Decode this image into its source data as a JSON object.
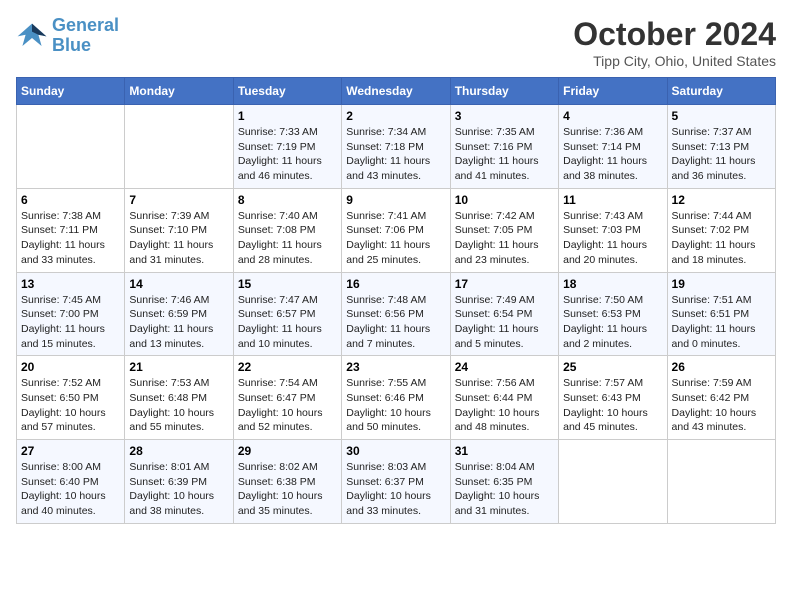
{
  "header": {
    "logo_line1": "General",
    "logo_line2": "Blue",
    "month": "October 2024",
    "location": "Tipp City, Ohio, United States"
  },
  "weekdays": [
    "Sunday",
    "Monday",
    "Tuesday",
    "Wednesday",
    "Thursday",
    "Friday",
    "Saturday"
  ],
  "weeks": [
    [
      {
        "day": "",
        "sunrise": "",
        "sunset": "",
        "daylight": ""
      },
      {
        "day": "",
        "sunrise": "",
        "sunset": "",
        "daylight": ""
      },
      {
        "day": "1",
        "sunrise": "Sunrise: 7:33 AM",
        "sunset": "Sunset: 7:19 PM",
        "daylight": "Daylight: 11 hours and 46 minutes."
      },
      {
        "day": "2",
        "sunrise": "Sunrise: 7:34 AM",
        "sunset": "Sunset: 7:18 PM",
        "daylight": "Daylight: 11 hours and 43 minutes."
      },
      {
        "day": "3",
        "sunrise": "Sunrise: 7:35 AM",
        "sunset": "Sunset: 7:16 PM",
        "daylight": "Daylight: 11 hours and 41 minutes."
      },
      {
        "day": "4",
        "sunrise": "Sunrise: 7:36 AM",
        "sunset": "Sunset: 7:14 PM",
        "daylight": "Daylight: 11 hours and 38 minutes."
      },
      {
        "day": "5",
        "sunrise": "Sunrise: 7:37 AM",
        "sunset": "Sunset: 7:13 PM",
        "daylight": "Daylight: 11 hours and 36 minutes."
      }
    ],
    [
      {
        "day": "6",
        "sunrise": "Sunrise: 7:38 AM",
        "sunset": "Sunset: 7:11 PM",
        "daylight": "Daylight: 11 hours and 33 minutes."
      },
      {
        "day": "7",
        "sunrise": "Sunrise: 7:39 AM",
        "sunset": "Sunset: 7:10 PM",
        "daylight": "Daylight: 11 hours and 31 minutes."
      },
      {
        "day": "8",
        "sunrise": "Sunrise: 7:40 AM",
        "sunset": "Sunset: 7:08 PM",
        "daylight": "Daylight: 11 hours and 28 minutes."
      },
      {
        "day": "9",
        "sunrise": "Sunrise: 7:41 AM",
        "sunset": "Sunset: 7:06 PM",
        "daylight": "Daylight: 11 hours and 25 minutes."
      },
      {
        "day": "10",
        "sunrise": "Sunrise: 7:42 AM",
        "sunset": "Sunset: 7:05 PM",
        "daylight": "Daylight: 11 hours and 23 minutes."
      },
      {
        "day": "11",
        "sunrise": "Sunrise: 7:43 AM",
        "sunset": "Sunset: 7:03 PM",
        "daylight": "Daylight: 11 hours and 20 minutes."
      },
      {
        "day": "12",
        "sunrise": "Sunrise: 7:44 AM",
        "sunset": "Sunset: 7:02 PM",
        "daylight": "Daylight: 11 hours and 18 minutes."
      }
    ],
    [
      {
        "day": "13",
        "sunrise": "Sunrise: 7:45 AM",
        "sunset": "Sunset: 7:00 PM",
        "daylight": "Daylight: 11 hours and 15 minutes."
      },
      {
        "day": "14",
        "sunrise": "Sunrise: 7:46 AM",
        "sunset": "Sunset: 6:59 PM",
        "daylight": "Daylight: 11 hours and 13 minutes."
      },
      {
        "day": "15",
        "sunrise": "Sunrise: 7:47 AM",
        "sunset": "Sunset: 6:57 PM",
        "daylight": "Daylight: 11 hours and 10 minutes."
      },
      {
        "day": "16",
        "sunrise": "Sunrise: 7:48 AM",
        "sunset": "Sunset: 6:56 PM",
        "daylight": "Daylight: 11 hours and 7 minutes."
      },
      {
        "day": "17",
        "sunrise": "Sunrise: 7:49 AM",
        "sunset": "Sunset: 6:54 PM",
        "daylight": "Daylight: 11 hours and 5 minutes."
      },
      {
        "day": "18",
        "sunrise": "Sunrise: 7:50 AM",
        "sunset": "Sunset: 6:53 PM",
        "daylight": "Daylight: 11 hours and 2 minutes."
      },
      {
        "day": "19",
        "sunrise": "Sunrise: 7:51 AM",
        "sunset": "Sunset: 6:51 PM",
        "daylight": "Daylight: 11 hours and 0 minutes."
      }
    ],
    [
      {
        "day": "20",
        "sunrise": "Sunrise: 7:52 AM",
        "sunset": "Sunset: 6:50 PM",
        "daylight": "Daylight: 10 hours and 57 minutes."
      },
      {
        "day": "21",
        "sunrise": "Sunrise: 7:53 AM",
        "sunset": "Sunset: 6:48 PM",
        "daylight": "Daylight: 10 hours and 55 minutes."
      },
      {
        "day": "22",
        "sunrise": "Sunrise: 7:54 AM",
        "sunset": "Sunset: 6:47 PM",
        "daylight": "Daylight: 10 hours and 52 minutes."
      },
      {
        "day": "23",
        "sunrise": "Sunrise: 7:55 AM",
        "sunset": "Sunset: 6:46 PM",
        "daylight": "Daylight: 10 hours and 50 minutes."
      },
      {
        "day": "24",
        "sunrise": "Sunrise: 7:56 AM",
        "sunset": "Sunset: 6:44 PM",
        "daylight": "Daylight: 10 hours and 48 minutes."
      },
      {
        "day": "25",
        "sunrise": "Sunrise: 7:57 AM",
        "sunset": "Sunset: 6:43 PM",
        "daylight": "Daylight: 10 hours and 45 minutes."
      },
      {
        "day": "26",
        "sunrise": "Sunrise: 7:59 AM",
        "sunset": "Sunset: 6:42 PM",
        "daylight": "Daylight: 10 hours and 43 minutes."
      }
    ],
    [
      {
        "day": "27",
        "sunrise": "Sunrise: 8:00 AM",
        "sunset": "Sunset: 6:40 PM",
        "daylight": "Daylight: 10 hours and 40 minutes."
      },
      {
        "day": "28",
        "sunrise": "Sunrise: 8:01 AM",
        "sunset": "Sunset: 6:39 PM",
        "daylight": "Daylight: 10 hours and 38 minutes."
      },
      {
        "day": "29",
        "sunrise": "Sunrise: 8:02 AM",
        "sunset": "Sunset: 6:38 PM",
        "daylight": "Daylight: 10 hours and 35 minutes."
      },
      {
        "day": "30",
        "sunrise": "Sunrise: 8:03 AM",
        "sunset": "Sunset: 6:37 PM",
        "daylight": "Daylight: 10 hours and 33 minutes."
      },
      {
        "day": "31",
        "sunrise": "Sunrise: 8:04 AM",
        "sunset": "Sunset: 6:35 PM",
        "daylight": "Daylight: 10 hours and 31 minutes."
      },
      {
        "day": "",
        "sunrise": "",
        "sunset": "",
        "daylight": ""
      },
      {
        "day": "",
        "sunrise": "",
        "sunset": "",
        "daylight": ""
      }
    ]
  ]
}
